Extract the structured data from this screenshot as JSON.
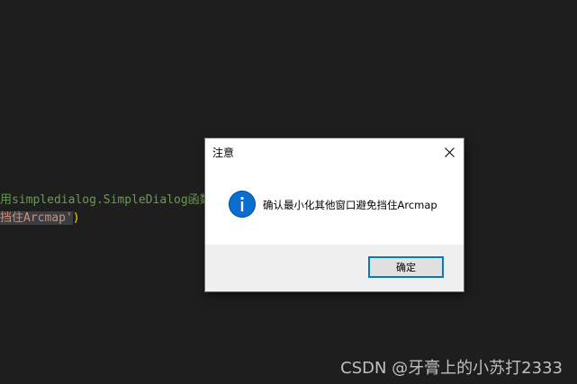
{
  "editor": {
    "line1": "用simpledialog.SimpleDialog函数",
    "line2_string": "挡住Arcmap'",
    "line2_paren": ")"
  },
  "dialog": {
    "title": "注意",
    "message": "确认最小化其他窗口避免挡住Arcmap",
    "ok_label": "确定",
    "icon": "info-icon",
    "close_icon": "close-icon"
  },
  "watermark": "CSDN @牙膏上的小苏打2333",
  "colors": {
    "editor_bg": "#1e1e1e",
    "comment": "#6a9955",
    "string": "#ce9178",
    "bracket": "#ffd700",
    "dialog_bg": "#ffffff",
    "footer_bg": "#f0f0f0",
    "accent": "#0078d7",
    "info_blue": "#0a6ed1"
  }
}
